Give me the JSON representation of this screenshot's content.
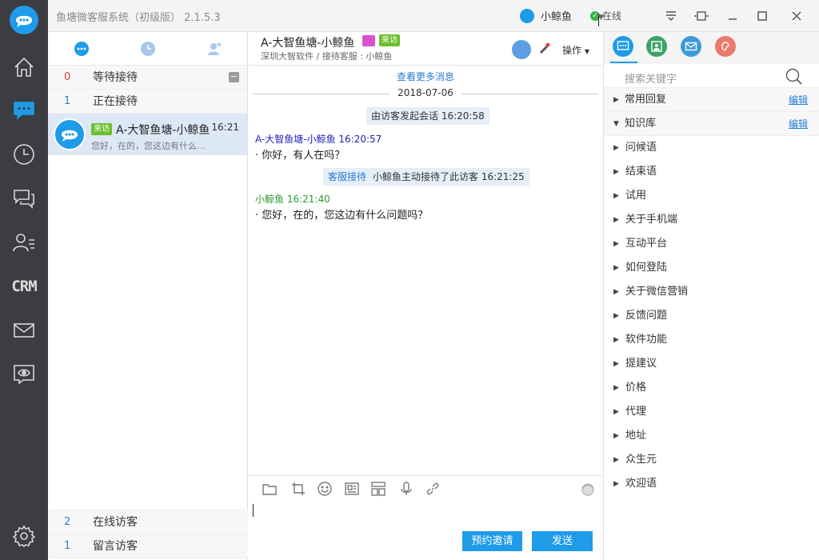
{
  "app": {
    "title": "鱼塘微客服系统（初级版） 2.1.5.3",
    "user_name": "小鲸鱼",
    "status": "在线"
  },
  "nav": {
    "items": [
      "home-icon",
      "chat-icon",
      "clock-icon",
      "messages-icon",
      "contacts-icon",
      "crm",
      "mail-icon",
      "monitor-icon",
      "settings-icon"
    ],
    "crm_label": "CRM"
  },
  "list": {
    "groups": {
      "waiting": {
        "count": "0",
        "label": "等待接待"
      },
      "serving": {
        "count": "1",
        "label": "正在接待"
      },
      "online": {
        "count": "2",
        "label": "在线访客"
      },
      "message": {
        "count": "1",
        "label": "留言访客"
      }
    },
    "conversation": {
      "tag": "来访",
      "name": "A-大智鱼塘-小鲸鱼",
      "time": "16:21",
      "preview": "您好，在的，您这边有什么问题吗？"
    }
  },
  "chat": {
    "name": "A-大智鱼塘-小鲸鱼",
    "tag": "来访",
    "subtitle": "深圳大智软件 / 接待客服 : 小鲸鱼",
    "operation": "操作",
    "more_messages": "查看更多消息",
    "date": "2018-07-06",
    "system_start": "由访客发起会话 16:20:58",
    "system_accept_label": "客服接待",
    "system_accept_text": "小鲸鱼主动接待了此访客  16:21:25",
    "messages": [
      {
        "sender": "A-大智鱼塘-小鲸鱼 16:20:57",
        "text": "· 你好，有人在吗？",
        "color": "#2222bb"
      },
      {
        "sender": "小鲸鱼   16:21:40",
        "text": "· 您好，在的，您这边有什么问题吗？",
        "color": "#2e9a2e"
      }
    ],
    "btn_invite": "预约邀请",
    "btn_send": "发送"
  },
  "right": {
    "search_placeholder": "搜索关键字",
    "sections": [
      {
        "label": "常用回复",
        "edit": "编辑",
        "expanded": false
      },
      {
        "label": "知识库",
        "edit": "编辑",
        "expanded": true
      }
    ],
    "kb_items": [
      "问候语",
      "结束语",
      "试用",
      "关于手机端",
      "互动平台",
      "如何登陆",
      "关于微信营销",
      "反馈问题",
      "软件功能",
      "提建议",
      "价格",
      "代理",
      "地址",
      "众生元",
      "欢迎语"
    ]
  },
  "colors": {
    "accent": "#1e9be9",
    "rail": "#3b3d41",
    "visitor_tag": "#6cbf2c"
  }
}
